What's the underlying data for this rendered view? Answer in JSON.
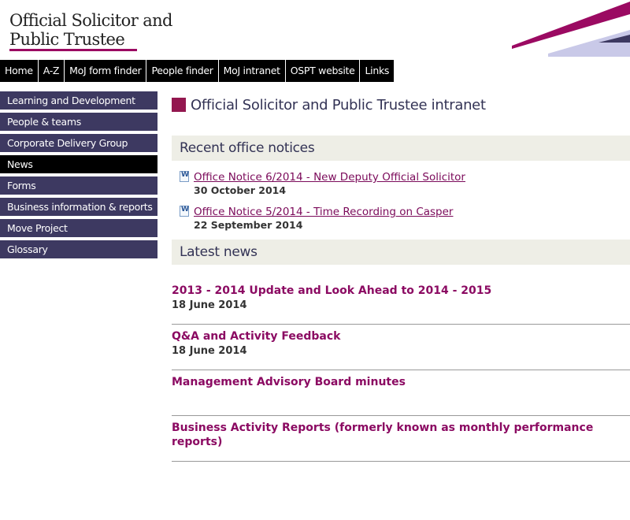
{
  "logo": {
    "line1": "Official Solicitor and",
    "line2": "Public Trustee"
  },
  "topnav": [
    "Home",
    "A-Z",
    "MoJ form finder",
    "People finder",
    "MoJ intranet",
    "OSPT website",
    "Links"
  ],
  "sidenav": [
    "Learning and Development",
    "People & teams",
    "Corporate Delivery Group",
    "News",
    "Forms",
    "Business information & reports",
    "Move Project",
    "Glossary"
  ],
  "sidenav_active": "News",
  "main": {
    "title": "Official Solicitor and Public Trustee intranet",
    "notices_heading": "Recent office notices",
    "notices": [
      {
        "title": "Office Notice 6/2014 - New Deputy Official Solicitor",
        "date": "30 October 2014"
      },
      {
        "title": "Office Notice 5/2014 - Time Recording on Casper",
        "date": "22 September 2014"
      }
    ],
    "news_heading": "Latest news",
    "news": [
      {
        "title": "2013 - 2014 Update and Look Ahead to 2014 - 2015",
        "date": "18 June 2014"
      },
      {
        "title": "Q&A and Activity Feedback",
        "date": "18 June 2014"
      },
      {
        "title": "Management Advisory Board minutes",
        "date": ""
      },
      {
        "title": "Business Activity Reports (formerly known as monthly performance reports)",
        "date": ""
      }
    ]
  },
  "colors": {
    "brand": "#9b0a62",
    "nav": "#3d3961",
    "link": "#7b0a5a"
  }
}
